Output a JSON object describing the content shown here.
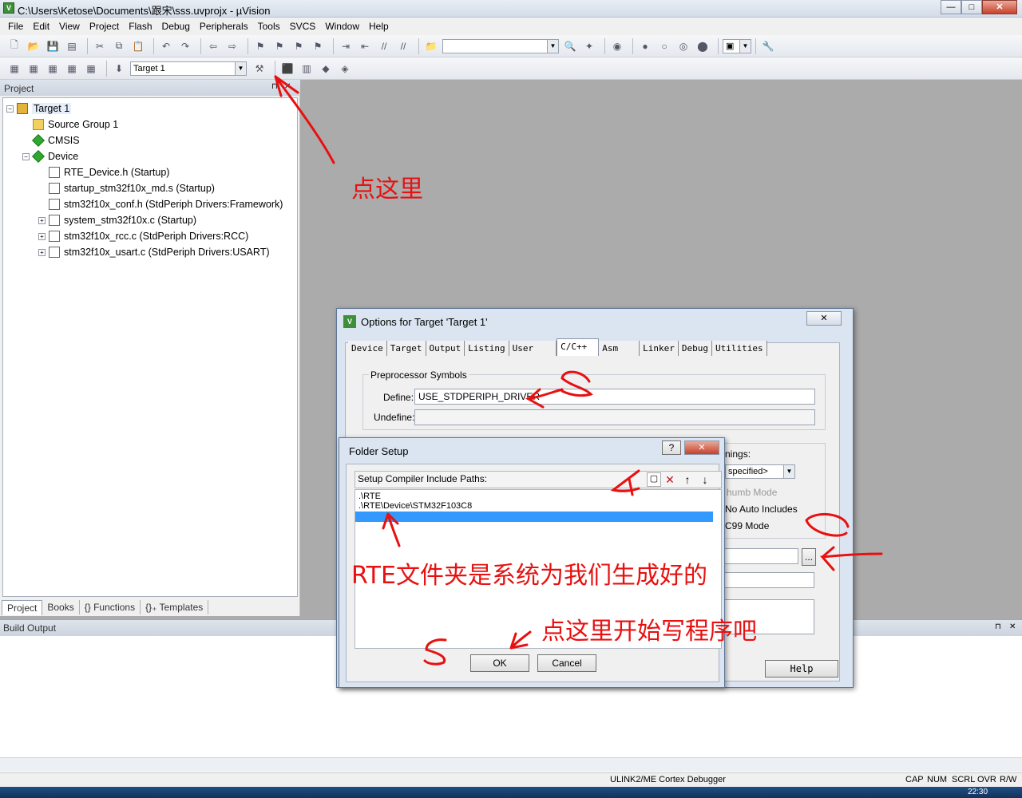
{
  "window": {
    "title": "C:\\Users\\Ketose\\Documents\\跟宋\\sss.uvprojx - µVision",
    "min": "—",
    "max": "□",
    "close": "✕"
  },
  "menu": [
    "File",
    "Edit",
    "View",
    "Project",
    "Flash",
    "Debug",
    "Peripherals",
    "Tools",
    "SVCS",
    "Window",
    "Help"
  ],
  "toolbar2": {
    "target": "Target 1"
  },
  "project": {
    "header": "Project",
    "tree": [
      {
        "label": "Target 1",
        "level": 0,
        "icon": "target-icon",
        "exp": "⊟"
      },
      {
        "label": "Source Group 1",
        "level": 1,
        "icon": "folder-icon",
        "exp": ""
      },
      {
        "label": "CMSIS",
        "level": 1,
        "icon": "diamond-icon",
        "exp": ""
      },
      {
        "label": "Device",
        "level": 1,
        "icon": "diamond-icon",
        "exp": "⊟"
      },
      {
        "label": "RTE_Device.h (Startup)",
        "level": 2,
        "icon": "file-icon",
        "exp": ""
      },
      {
        "label": "startup_stm32f10x_md.s (Startup)",
        "level": 2,
        "icon": "file-icon",
        "exp": ""
      },
      {
        "label": "stm32f10x_conf.h (StdPeriph Drivers:Framework)",
        "level": 2,
        "icon": "file-icon",
        "exp": ""
      },
      {
        "label": "system_stm32f10x.c (Startup)",
        "level": 2,
        "icon": "file-icon",
        "exp": "⊞"
      },
      {
        "label": "stm32f10x_rcc.c (StdPeriph Drivers:RCC)",
        "level": 2,
        "icon": "file-icon",
        "exp": "⊞"
      },
      {
        "label": "stm32f10x_usart.c (StdPeriph Drivers:USART)",
        "level": 2,
        "icon": "file-icon",
        "exp": "⊞"
      }
    ],
    "tabs": [
      "Project",
      "Books",
      "{} Functions",
      "{}₊ Templates"
    ]
  },
  "build": {
    "header": "Build Output"
  },
  "status": {
    "debugger": "ULINK2/ME Cortex Debugger",
    "flags": [
      "CAP",
      "NUM",
      "SCRL",
      "OVR",
      "R/W"
    ],
    "time": "22:30"
  },
  "options": {
    "title": "Options for Target 'Target 1'",
    "tabs": [
      "Device",
      "Target",
      "Output",
      "Listing",
      "User",
      "C/C++",
      "Asm",
      "Linker",
      "Debug",
      "Utilities"
    ],
    "active_tab": "C/C++",
    "pre_group": "Preprocessor Symbols",
    "define_label": "Define:",
    "define_value": "USE_STDPERIPH_DRIVER",
    "undefine_label": "Undefine:",
    "right_group_partial": "nings:",
    "right_combo": "specified>",
    "right_items": [
      "humb Mode",
      "No Auto Includes",
      "C99 Mode"
    ],
    "browse": "...",
    "help": "Help"
  },
  "folder": {
    "title": "Folder Setup",
    "help_btn": "?",
    "close_btn": "✕",
    "label": "Setup Compiler Include Paths:",
    "paths": [
      ".\\RTE",
      ".\\RTE\\Device\\STM32F103C8",
      ""
    ],
    "ok": "OK",
    "cancel": "Cancel",
    "tool_icons": [
      "new-folder-icon",
      "delete-icon",
      "move-up-icon",
      "move-down-icon"
    ]
  },
  "annotations": {
    "click_here": "点这里",
    "rte_note": "RTE文件夹是系统为我们生成好的",
    "start_note": "点这里开始写程序吧"
  },
  "colors": {
    "ann": "#e81010",
    "select": "#3399ff"
  }
}
